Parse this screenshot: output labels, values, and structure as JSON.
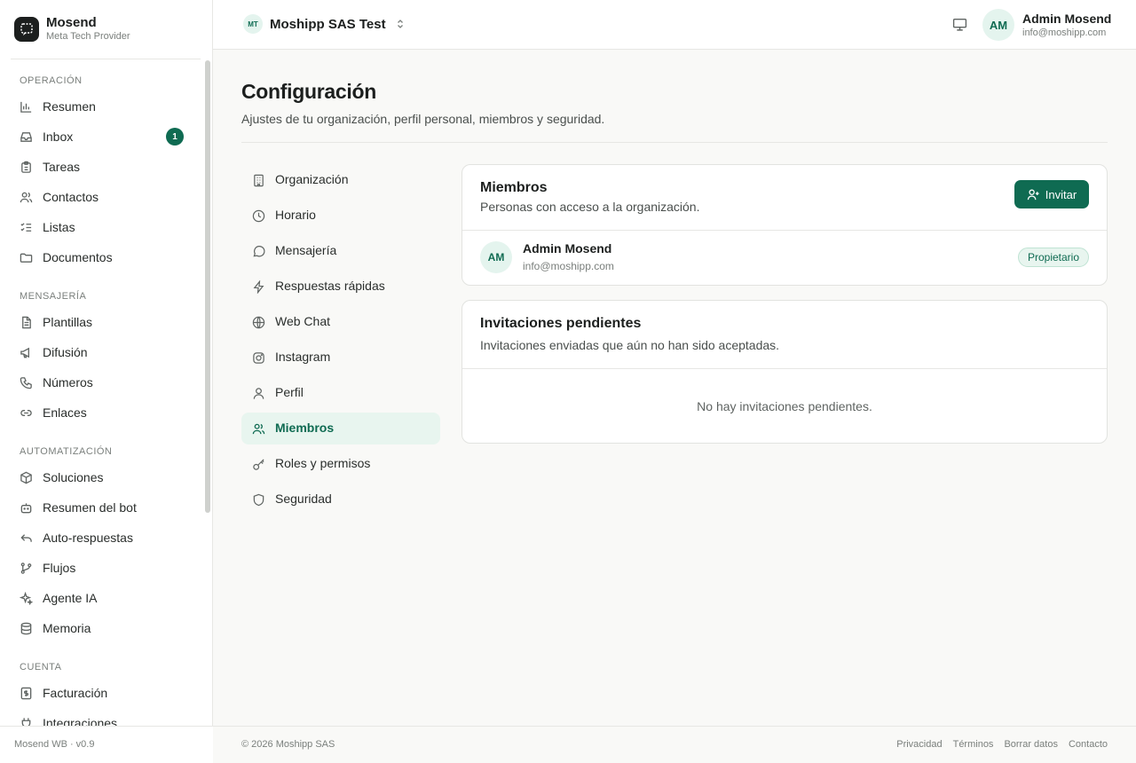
{
  "brand": {
    "name": "Mosend",
    "subtitle": "Meta Tech Provider",
    "version": "Mosend WB · v0.9"
  },
  "sidebar": {
    "sections": [
      {
        "title": "OPERACIÓN",
        "items": [
          {
            "label": "Resumen",
            "icon": "bar-chart-icon"
          },
          {
            "label": "Inbox",
            "icon": "inbox-icon",
            "badge": "1"
          },
          {
            "label": "Tareas",
            "icon": "clipboard-icon"
          },
          {
            "label": "Contactos",
            "icon": "users-icon"
          },
          {
            "label": "Listas",
            "icon": "list-checks-icon"
          },
          {
            "label": "Documentos",
            "icon": "folder-icon"
          }
        ]
      },
      {
        "title": "MENSAJERÍA",
        "items": [
          {
            "label": "Plantillas",
            "icon": "file-text-icon"
          },
          {
            "label": "Difusión",
            "icon": "megaphone-icon"
          },
          {
            "label": "Números",
            "icon": "phone-icon"
          },
          {
            "label": "Enlaces",
            "icon": "link-icon"
          }
        ]
      },
      {
        "title": "AUTOMATIZACIÓN",
        "items": [
          {
            "label": "Soluciones",
            "icon": "package-icon"
          },
          {
            "label": "Resumen del bot",
            "icon": "bot-icon"
          },
          {
            "label": "Auto-respuestas",
            "icon": "reply-icon"
          },
          {
            "label": "Flujos",
            "icon": "git-branch-icon"
          },
          {
            "label": "Agente IA",
            "icon": "sparkles-icon"
          },
          {
            "label": "Memoria",
            "icon": "database-icon"
          }
        ]
      },
      {
        "title": "CUENTA",
        "items": [
          {
            "label": "Facturación",
            "icon": "receipt-icon"
          },
          {
            "label": "Integraciones",
            "icon": "plug-icon"
          }
        ]
      }
    ]
  },
  "topbar": {
    "org_initials": "MT",
    "org_name": "Moshipp SAS Test",
    "user_initials": "AM",
    "user_name": "Admin Mosend",
    "user_email": "info@moshipp.com"
  },
  "page": {
    "title": "Configuración",
    "subtitle": "Ajustes de tu organización, perfil personal, miembros y seguridad."
  },
  "settings_nav": [
    {
      "label": "Organización",
      "icon": "building-icon"
    },
    {
      "label": "Horario",
      "icon": "clock-icon"
    },
    {
      "label": "Mensajería",
      "icon": "message-circle-icon"
    },
    {
      "label": "Respuestas rápidas",
      "icon": "zap-icon"
    },
    {
      "label": "Web Chat",
      "icon": "globe-icon"
    },
    {
      "label": "Instagram",
      "icon": "instagram-icon"
    },
    {
      "label": "Perfil",
      "icon": "user-icon"
    },
    {
      "label": "Miembros",
      "icon": "users-icon",
      "active": true
    },
    {
      "label": "Roles y permisos",
      "icon": "key-icon"
    },
    {
      "label": "Seguridad",
      "icon": "shield-icon"
    }
  ],
  "members_card": {
    "title": "Miembros",
    "subtitle": "Personas con acceso a la organización.",
    "invite_label": "Invitar",
    "members": [
      {
        "initials": "AM",
        "name": "Admin Mosend",
        "email": "info@moshipp.com",
        "role": "Propietario"
      }
    ]
  },
  "invitations_card": {
    "title": "Invitaciones pendientes",
    "subtitle": "Invitaciones enviadas que aún no han sido aceptadas.",
    "empty": "No hay invitaciones pendientes."
  },
  "footer": {
    "copyright": "© 2026 Moshipp SAS",
    "links": [
      "Privacidad",
      "Términos",
      "Borrar datos",
      "Contacto"
    ]
  },
  "colors": {
    "accent": "#0f6b52",
    "accent_soft": "#e8f5ef",
    "background": "#f9f9f7"
  }
}
